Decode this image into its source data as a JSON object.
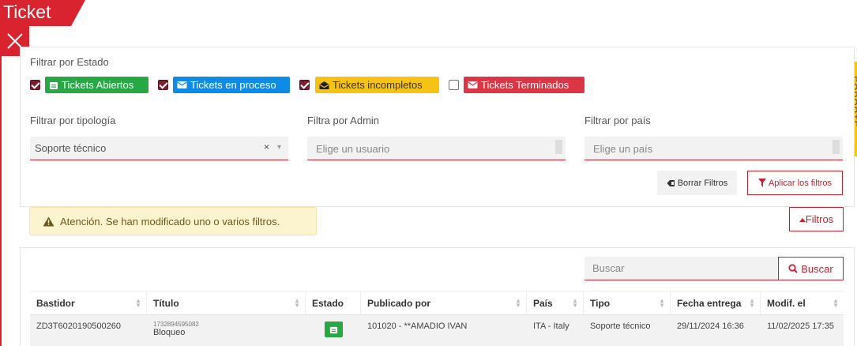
{
  "window": {
    "tab_title": "Ticket"
  },
  "side_tab": {
    "label": "SOPORTE"
  },
  "filters": {
    "estado_label": "Filtrar por Estado",
    "states": [
      {
        "label": "Tickets Abiertos",
        "checked": true,
        "color": "#28a745",
        "icon": "ticket-icon"
      },
      {
        "label": "Tickets en proceso",
        "checked": true,
        "color": "#0d8be5",
        "icon": "envelope-icon"
      },
      {
        "label": "Tickets incompletos",
        "checked": true,
        "color": "#f7c313",
        "icon": "envelope-open-icon"
      },
      {
        "label": "Tickets Terminados",
        "checked": false,
        "color": "#dc3545",
        "icon": "envelope-icon"
      }
    ],
    "tipologia": {
      "label": "Filtrar por tipología",
      "value": "Soporte técnico",
      "clear": "×",
      "arrow": "▾"
    },
    "admin": {
      "label": "Filtra por Admin",
      "placeholder": "Elige un usuario"
    },
    "pais": {
      "label": "Filtrar por país",
      "placeholder": "Elige un país"
    },
    "clear_button": "Borrar Filtros",
    "apply_button": "Aplicar los filtros"
  },
  "alert": {
    "text": "Atención. Se han modificado uno o varios filtros."
  },
  "toggle_filters": {
    "label": "Filtros"
  },
  "search": {
    "placeholder": "Buscar",
    "button": "Buscar"
  },
  "table": {
    "columns": [
      "Bastidor",
      "Título",
      "Estado",
      "Publicado por",
      "País",
      "Tipo",
      "Fecha entrega",
      "Modif. el"
    ],
    "rows": [
      {
        "bastidor": "ZD3T6020190500260",
        "titulo_id": "1732894595082",
        "titulo": "Bloqueo",
        "estado_icon": "ticket-icon",
        "publicado_por": "101020 - **AMADIO IVAN",
        "pais": "ITA - Italy",
        "tipo": "Soporte técnico",
        "fecha_entrega": "29/11/2024 16:36",
        "modificado": "11/02/2025 17:35"
      }
    ]
  },
  "colors": {
    "accent": "#c9202e",
    "warning_bg": "#fcf3cf"
  }
}
